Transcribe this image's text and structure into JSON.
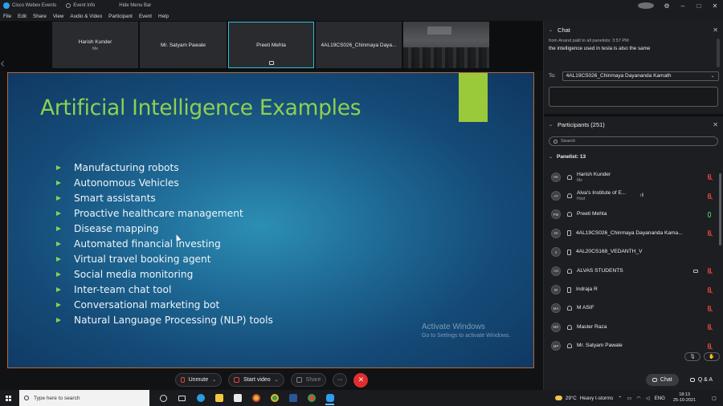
{
  "titlebar": {
    "app_name": "Cisco Webex Events",
    "event_info": "Event Info",
    "hide_menu": "Hide Menu Bar",
    "min": "–",
    "max": "□",
    "close": "✕"
  },
  "menu": [
    "File",
    "Edit",
    "Share",
    "View",
    "Audio & Video",
    "Participant",
    "Event",
    "Help"
  ],
  "thumbnails": [
    {
      "name": "Harish Kunder",
      "sub": "Me"
    },
    {
      "name": "Mr. Satyam Pawale",
      "sub": ""
    },
    {
      "name": "Preeti Mehta",
      "sub": ""
    },
    {
      "name": "4AL19CS026_Chinmaya Daya...",
      "sub": ""
    }
  ],
  "slide": {
    "title": "Artificial Intelligence Examples",
    "bullets": [
      "Manufacturing robots",
      "Autonomous Vehicles",
      "Smart assistants",
      "Proactive healthcare management",
      "Disease mapping",
      "Automated financial investing",
      "Virtual travel booking agent",
      "Social media monitoring",
      "Inter-team chat tool",
      "Conversational marketing bot",
      "Natural Language Processing (NLP) tools"
    ],
    "watermark_title": "Activate Windows",
    "watermark_sub": "Go to Settings to activate Windows."
  },
  "controls": {
    "unmute": "Unmute",
    "start_video": "Start video",
    "share": "Share",
    "more": "···",
    "leave": "✕"
  },
  "chat": {
    "title": "Chat",
    "from": "from Anand patil to all panelists:   3:57 PM",
    "message": "the intelligence used in tesla is also the same",
    "to_label": "To:",
    "to_value": "4AL19CS026_Chinmaya Dayananda Kamath"
  },
  "participants": {
    "title": "Participants (251)",
    "search_placeholder": "Search",
    "panelist_header": "Panelist: 13",
    "list": [
      {
        "initials": "HK",
        "name": "Harish Kunder",
        "role": "Me",
        "device": "headset",
        "mic": "muted"
      },
      {
        "initials": "AT",
        "name": "Alva's Institute of E...",
        "role": "Host",
        "device": "headset",
        "mic": "muted"
      },
      {
        "initials": "PM",
        "name": "Preeti Mehta",
        "role": "",
        "device": "headset",
        "mic": "on"
      },
      {
        "initials": "4K",
        "name": "4AL19CS026_Chinmaya Dayananda Kama...",
        "role": "",
        "device": "device",
        "mic": "muted"
      },
      {
        "initials": "4",
        "name": "4AL20CS168_VEDANTH_V",
        "role": "",
        "device": "device",
        "mic": "none"
      },
      {
        "initials": "AS",
        "name": "ALVAS STUDENTS",
        "role": "",
        "device": "headset",
        "mic": "muted"
      },
      {
        "initials": "IR",
        "name": "Indraja R",
        "role": "",
        "device": "device",
        "mic": "muted"
      },
      {
        "initials": "MA",
        "name": "M ASIF",
        "role": "",
        "device": "headset",
        "mic": "muted"
      },
      {
        "initials": "MR",
        "name": "Master Raza",
        "role": "",
        "device": "headset",
        "mic": "muted"
      },
      {
        "initials": "MP",
        "name": "Mr. Satyam Pawale",
        "role": "",
        "device": "headset",
        "mic": "muted"
      }
    ]
  },
  "panel_bottom": {
    "chat": "Chat",
    "qa": "Q & A"
  },
  "taskbar": {
    "search_placeholder": "Type here to search",
    "weather_temp": "29°C",
    "weather_text": "Heavy t-storms",
    "time": "18:13",
    "date": "25-10-2021"
  }
}
